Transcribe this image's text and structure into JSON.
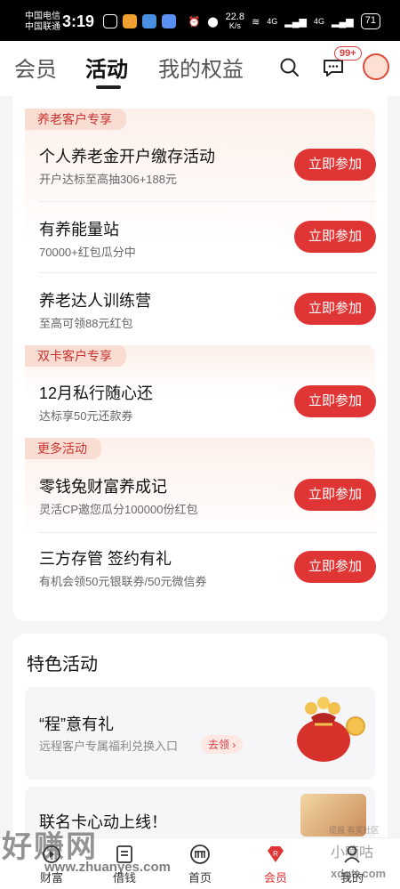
{
  "status_bar": {
    "carrier1": "中国电信",
    "carrier2": "中国联通",
    "time": "3:19",
    "net_speed": "22.8",
    "net_unit": "K/s",
    "signal1": "4G",
    "signal2": "4G",
    "battery": "71"
  },
  "header": {
    "tabs": [
      {
        "label": "会员"
      },
      {
        "label": "活动"
      },
      {
        "label": "我的权益"
      }
    ],
    "message_badge": "99+"
  },
  "sections": [
    {
      "label": "养老客户专享"
    },
    {
      "label": "双卡客户专享"
    },
    {
      "label": "更多活动"
    }
  ],
  "activities": [
    {
      "title": "个人养老金开户缴存活动",
      "subtitle": "开户达标至高抽306+188元",
      "button": "立即参加"
    },
    {
      "title": "有养能量站",
      "subtitle": "70000+红包瓜分中",
      "button": "立即参加"
    },
    {
      "title": "养老达人训练营",
      "subtitle": "至高可领88元红包",
      "button": "立即参加"
    },
    {
      "title": "12月私行随心还",
      "subtitle": "达标享50元还款券",
      "button": "立即参加"
    },
    {
      "title": "零钱兔财富养成记",
      "subtitle": "灵活CP邀您瓜分100000份红包",
      "button": "立即参加"
    },
    {
      "title": "三方存管 签约有礼",
      "subtitle": "有机会领50元银联券/50元微信券",
      "button": "立即参加"
    }
  ],
  "featured": {
    "title": "特色活动",
    "item1": {
      "title": "“程”意有礼",
      "subtitle": "远程客户专属福利兑换入口",
      "tag": "去领 ›"
    },
    "item2": {
      "title": "联名卡心动上线！"
    }
  },
  "bottom_nav": [
    {
      "label": "财富"
    },
    {
      "label": "借钱"
    },
    {
      "label": "首页"
    },
    {
      "label": "会员"
    },
    {
      "label": "我的"
    }
  ],
  "watermarks": {
    "left": "好赚网",
    "left_url": "www.zhuanyes.com",
    "right_top": "提报 有奖社区",
    "right": "小嘀咕",
    "right_url": "xdgtt.com"
  },
  "colors": {
    "accent": "#e03535",
    "section_bg": "#f9dcd2",
    "section_text": "#c9332f"
  }
}
